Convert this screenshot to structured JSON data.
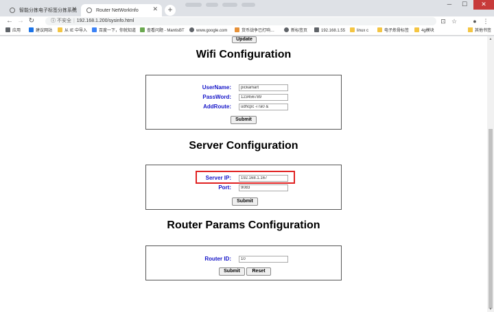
{
  "tabs": [
    {
      "title": "智能分拣电子标签分拣系统",
      "active": false
    },
    {
      "title": "Router NetWorkInfo",
      "active": true
    }
  ],
  "address_bar": {
    "security": "不安全",
    "url": "192.168.1.200/sysinfo.html"
  },
  "bookmarks": [
    {
      "label": "应用",
      "icon_color": "#5f6368"
    },
    {
      "label": "建议网站",
      "icon_color": "#1a73e8"
    },
    {
      "label": "从 IE 中导入",
      "icon_color": "#f4c542"
    },
    {
      "label": "百度一下，你就知道",
      "icon_color": "#3b82f6"
    },
    {
      "label": "查看问题 - MantisBT",
      "icon_color": "#6aa84f"
    },
    {
      "label": "www.google.com",
      "icon_color": "#5f6368"
    },
    {
      "label": "货币战争已打响…",
      "icon_color": "#e69138"
    },
    {
      "label": "新标签页",
      "icon_color": "#5f6368"
    },
    {
      "label": "192.168.1.55",
      "icon_color": "#5f6368"
    },
    {
      "label": "linux c",
      "icon_color": "#f4c542"
    },
    {
      "label": "电子炼骨标签",
      "icon_color": "#f4c542"
    },
    {
      "label": "4g模块",
      "icon_color": "#f4c542"
    }
  ],
  "bookmarks_other": "其他书签",
  "page": {
    "update_button": "Update",
    "wifi": {
      "title": "Wifi Configuration",
      "username_label": "UserName:",
      "username_value": "pickamart",
      "password_label": "PassWord:",
      "password_value": "123456789",
      "addroute_label": "AddRoute:",
      "addroute_value": "udhcpc -i ra0 &",
      "submit": "Submit"
    },
    "server": {
      "title": "Server Configuration",
      "ip_label": "Server IP:",
      "ip_value": "192.168.1.167",
      "port_label": "Port:",
      "port_value": "9083",
      "submit": "Submit"
    },
    "router": {
      "title": "Router Params Configuration",
      "id_label": "Router ID:",
      "id_value": "10",
      "submit": "Submit",
      "reset": "Reset"
    }
  },
  "colors": {
    "label_blue": "#1515c8",
    "highlight_red": "#e02020"
  }
}
